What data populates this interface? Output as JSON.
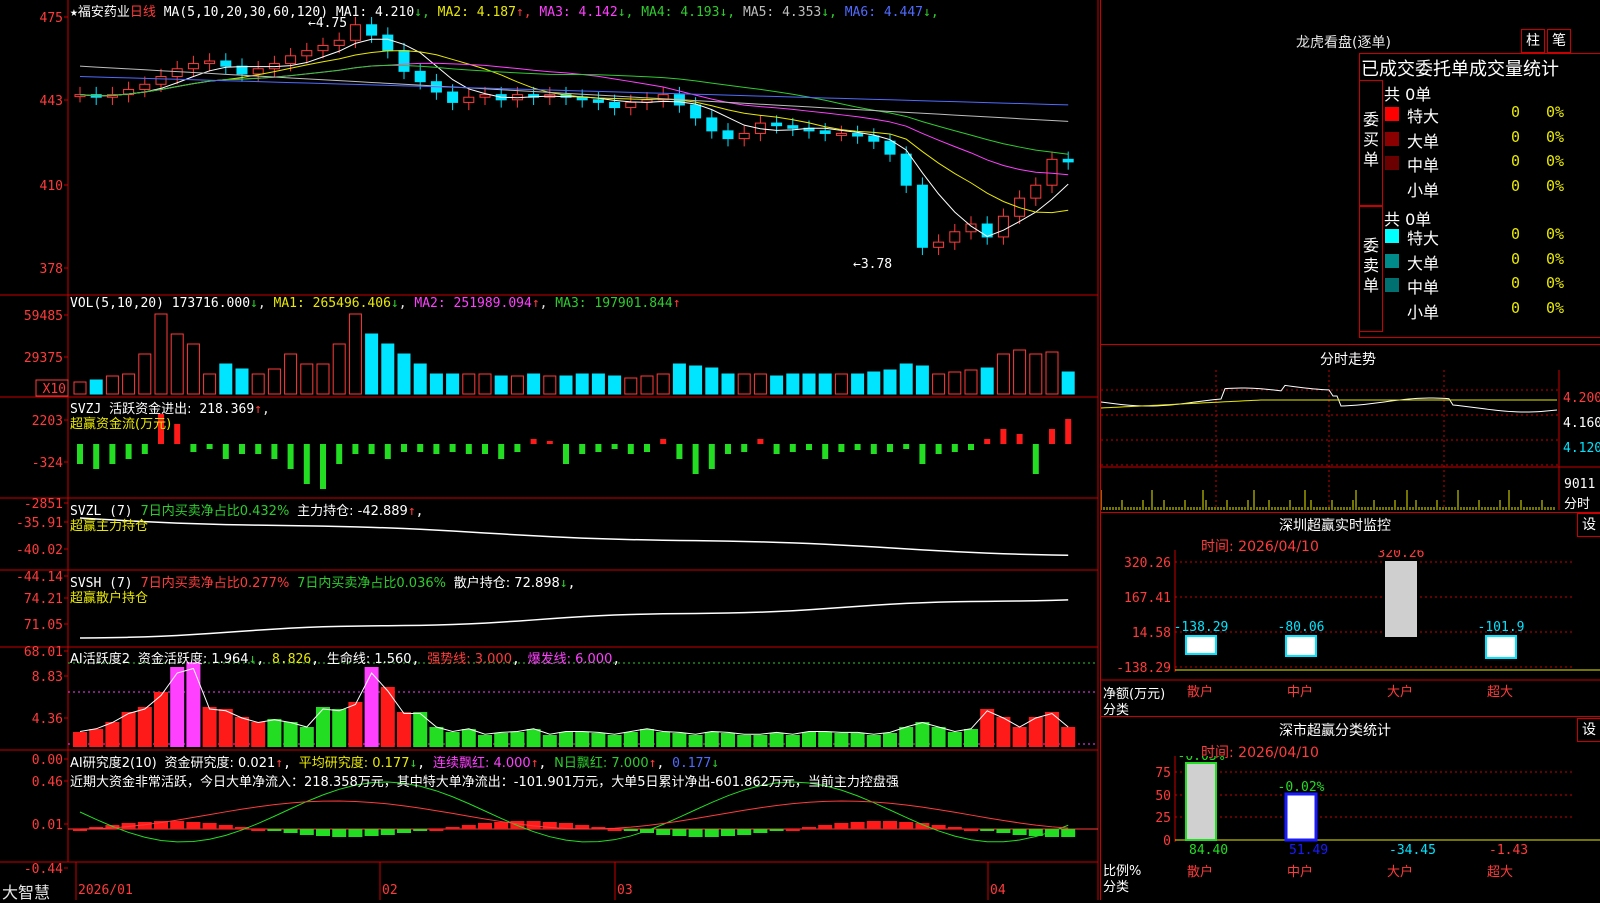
{
  "brand": "大智慧",
  "stock": {
    "star": "★",
    "name": "福安药业",
    "period": "日线",
    "ma_head": "MA(5,10,20,30,60,120)",
    "ma": [
      {
        "label": "MA1:",
        "value": "4.210",
        "arrow": "↓",
        "color": "#ffffff"
      },
      {
        "label": "MA2:",
        "value": "4.187",
        "arrow": "↑",
        "color": "#e8e800"
      },
      {
        "label": "MA3:",
        "value": "4.142",
        "arrow": "↓",
        "color": "#ff40ff"
      },
      {
        "label": "MA4:",
        "value": "4.193",
        "arrow": "↓",
        "color": "#2ecc2e"
      },
      {
        "label": "MA5:",
        "value": "4.353",
        "arrow": "↓",
        "color": "#bdbdbd"
      },
      {
        "label": "MA6:",
        "value": "4.447",
        "arrow": "↓",
        "color": "#4f6bff"
      }
    ],
    "high_mark": "4.75",
    "low_mark": "3.78",
    "axis": [
      "475",
      "443",
      "410",
      "378"
    ]
  },
  "vol": {
    "head": "VOL(5,10,20)",
    "value": "173716.000",
    "v_arrow": "↓",
    "ma1": "MA1: 265496.406",
    "ma1_arrow": "↓",
    "ma2": "MA2: 251989.094",
    "ma2_arrow": "↑",
    "ma3": "MA3: 197901.844",
    "ma3_arrow": "↑",
    "axis": [
      "59485",
      "29375"
    ],
    "unit": "X10"
  },
  "svzj": {
    "head": "SVZJ",
    "label": "活跃资金进出:",
    "value": "218.369",
    "arrow": "↑",
    "sub": "超赢资金流(万元)",
    "axis": [
      "2203",
      "-324",
      "-2851"
    ]
  },
  "svzl": {
    "head": "SVZL (7)",
    "t1": "7日内买卖净占比0.432%",
    "t2": "主力持仓: -42.889",
    "t2_arrow": "↑",
    "t2_tail": ",",
    "sub": "超赢主力持仓",
    "axis": [
      "-35.91",
      "-40.02",
      "-44.14"
    ]
  },
  "svsh": {
    "head": "SVSH (7)",
    "t1": "7日内买卖净占比0.277%",
    "t2": "7日内买卖净占比0.036%",
    "t3": "散户持仓: 72.898",
    "t3_arrow": "↓",
    "t3_tail": ",",
    "sub": "超赢散户持仓",
    "axis": [
      "74.21",
      "71.05",
      "68.01"
    ]
  },
  "ai1": {
    "head": "AI活跃度2",
    "a": "资金活跃度: 1.964",
    "a_arrow": "↓",
    "b": "8.826",
    "b_pre": ",",
    "c": "生命线: 1.560",
    "c_pre": ",",
    "d": "强势线: 3.000",
    "d_pre": ",",
    "e": "爆发线: 6.000",
    "e_pre": ",",
    "e_tail": ",",
    "axis": [
      "8.83",
      "4.36",
      "0.00"
    ]
  },
  "ai2": {
    "head": "AI研究度2(10)",
    "a": "资金研究度: 0.021",
    "a_arrow": "↑",
    "a_tail": ",",
    "b": "平均研究度: 0.177",
    "b_arrow": "↓",
    "b_tail": ",",
    "c": "连续飘红: 4.000",
    "c_arrow": "↑",
    "c_tail": ",",
    "d": "N日飘红: 7.000",
    "d_arrow": "↑",
    "d_tail": ",",
    "e": "0.177",
    "e_arrow": "↓",
    "summary": "近期大资金非常活跃，今日大单净流入：218.358万元，其中特大单净流出：-101.901万元，大单5日累计净出-601.862万元，当前主力控盘强",
    "axis": [
      "0.46",
      "0.01",
      "-0.44"
    ]
  },
  "xaxis": [
    "2026/01",
    "02",
    "03",
    "04"
  ],
  "lhkp": {
    "title": "龙虎看盘(逐单)",
    "btn1": "柱",
    "btn2": "笔",
    "section": "已成交委托单成交量统计",
    "buy": {
      "side": "委买单",
      "total": "共 0单",
      "rows": [
        {
          "label": "特大",
          "count": "0",
          "pct": "0%",
          "color": "#ff0000"
        },
        {
          "label": "大单",
          "count": "0",
          "pct": "0%",
          "color": "#8b0000"
        },
        {
          "label": "中单",
          "count": "0",
          "pct": "0%",
          "color": "#6b0000"
        },
        {
          "label": "小单",
          "count": "0",
          "pct": "0%",
          "color": "#000000"
        }
      ]
    },
    "sell": {
      "side": "委卖单",
      "total": "共 0单",
      "rows": [
        {
          "label": "特大",
          "count": "0",
          "pct": "0%",
          "color": "#00ffff"
        },
        {
          "label": "大单",
          "count": "0",
          "pct": "0%",
          "color": "#008b8b"
        },
        {
          "label": "中单",
          "count": "0",
          "pct": "0%",
          "color": "#007070"
        },
        {
          "label": "小单",
          "count": "0",
          "pct": "0%",
          "color": "#000000"
        }
      ]
    }
  },
  "fenshi": {
    "title": "分时走势",
    "p1": "4.200",
    "p2": "4.160",
    "p3": "4.120",
    "vol": "9011",
    "vol_label": "分时"
  },
  "sz_monitor": {
    "title": "深圳超赢实时监控",
    "btn": "设",
    "time": "时间: 2026/04/10",
    "axis": [
      "320.26",
      "167.41",
      "14.58",
      "-138.29"
    ],
    "ylabel": "净额(万元)",
    "xlabel": "分类",
    "labels": [
      "-138.29",
      "-80.06",
      "320.26",
      "-101.9"
    ],
    "cats": [
      "散户",
      "中户",
      "大户",
      "超大"
    ]
  },
  "sz_class": {
    "title": "深市超赢分类统计",
    "btn": "设",
    "time": "时间: 2026/04/10",
    "axis": [
      "75",
      "50",
      "25",
      "0"
    ],
    "ylabel": "比例%",
    "xlabel": "分类",
    "top_labels": [
      "-0.03%",
      "-0.02%"
    ],
    "values": [
      "84.40",
      "51.49",
      "-34.45",
      "-1.43"
    ],
    "cats": [
      "散户",
      "中户",
      "大户",
      "超大"
    ]
  },
  "colors": {
    "up": "#ff3b3b",
    "down": "#00e5ff",
    "grid": "#c80000"
  }
}
